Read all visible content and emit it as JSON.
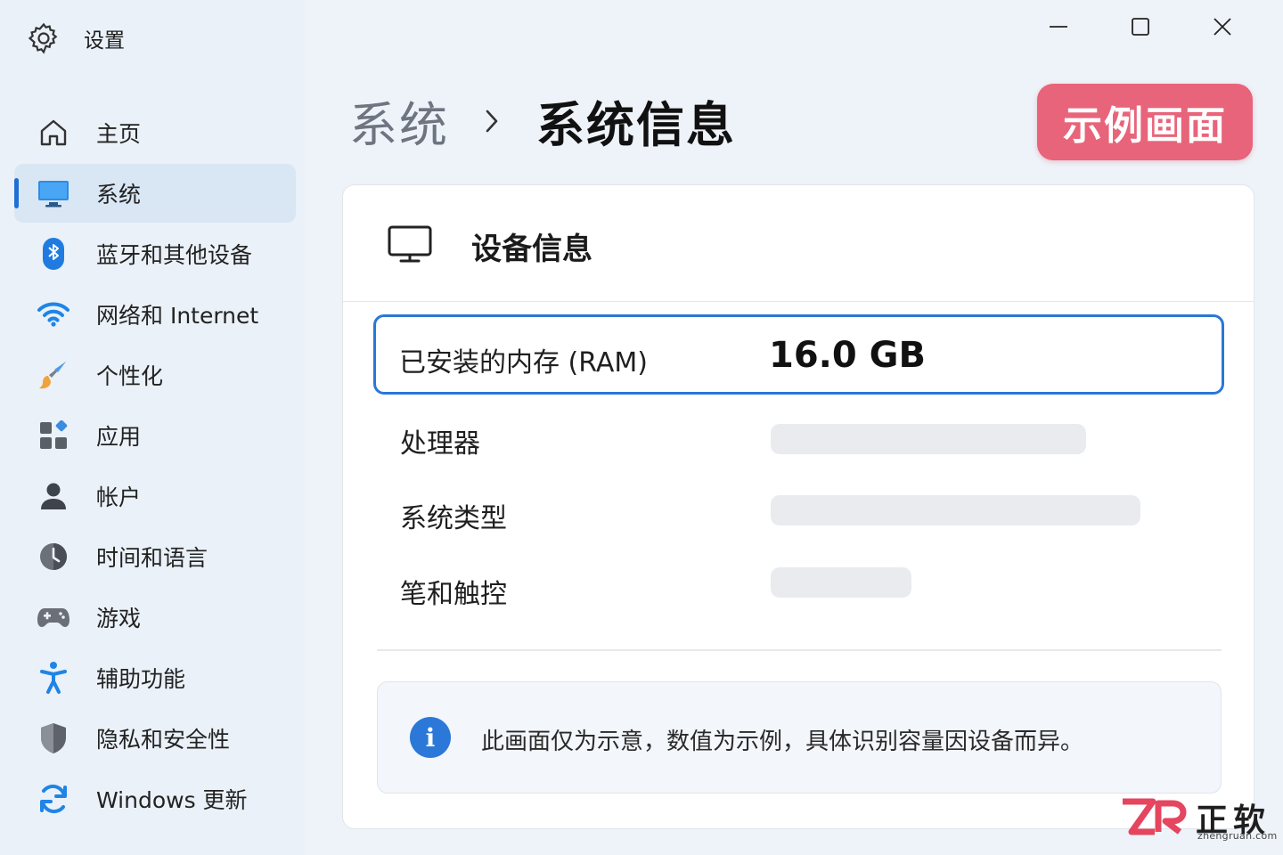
{
  "window": {
    "app_title": "设置",
    "icon": "gear-icon",
    "controls": {
      "minimize": "minimize-icon",
      "maximize": "maximize-icon",
      "close": "close-icon"
    }
  },
  "sidebar": {
    "items": [
      {
        "label": "主页",
        "icon": "home-icon",
        "active": false
      },
      {
        "label": "系统",
        "icon": "monitor-icon",
        "active": true
      },
      {
        "label": "蓝牙和其他设备",
        "icon": "bluetooth-icon",
        "active": false
      },
      {
        "label": "网络和 Internet",
        "icon": "wifi-icon",
        "active": false
      },
      {
        "label": "个性化",
        "icon": "brush-icon",
        "active": false
      },
      {
        "label": "应用",
        "icon": "apps-icon",
        "active": false
      },
      {
        "label": "帐户",
        "icon": "person-icon",
        "active": false
      },
      {
        "label": "时间和语言",
        "icon": "clock-icon",
        "active": false
      },
      {
        "label": "游戏",
        "icon": "gamepad-icon",
        "active": false
      },
      {
        "label": "辅助功能",
        "icon": "accessibility-icon",
        "active": false
      },
      {
        "label": "隐私和安全性",
        "icon": "shield-icon",
        "active": false
      },
      {
        "label": "Windows 更新",
        "icon": "refresh-icon",
        "active": false
      }
    ]
  },
  "header": {
    "breadcrumb_parent": "系统",
    "breadcrumb_separator": "chevron-right-icon",
    "breadcrumb_current": "系统信息",
    "badge": "示例画面"
  },
  "device_card": {
    "title": "设备信息",
    "icon": "monitor-icon",
    "rows": [
      {
        "label": "已安装的内存 (RAM)",
        "value": "16.0 GB",
        "highlighted": true
      },
      {
        "label": "处理器",
        "value": "",
        "placeholder": true
      },
      {
        "label": "系统类型",
        "value": "",
        "placeholder": true
      },
      {
        "label": "笔和触控",
        "value": "",
        "placeholder": true
      }
    ],
    "note": "此画面仅为示意，数值为示例，具体识别容量因设备而异。",
    "note_icon": "info-icon"
  },
  "watermark": {
    "logo_text": "ZR",
    "name": "正软",
    "domain": "zhengruan.com"
  },
  "colors": {
    "accent": "#1f6fd4",
    "badge": "#e8647a",
    "sidebar_bg": "#eaf1f8",
    "active_item_bg": "#d9e6f3",
    "placeholder": "#e9ebee",
    "watermark_logo": "#e5455f"
  }
}
